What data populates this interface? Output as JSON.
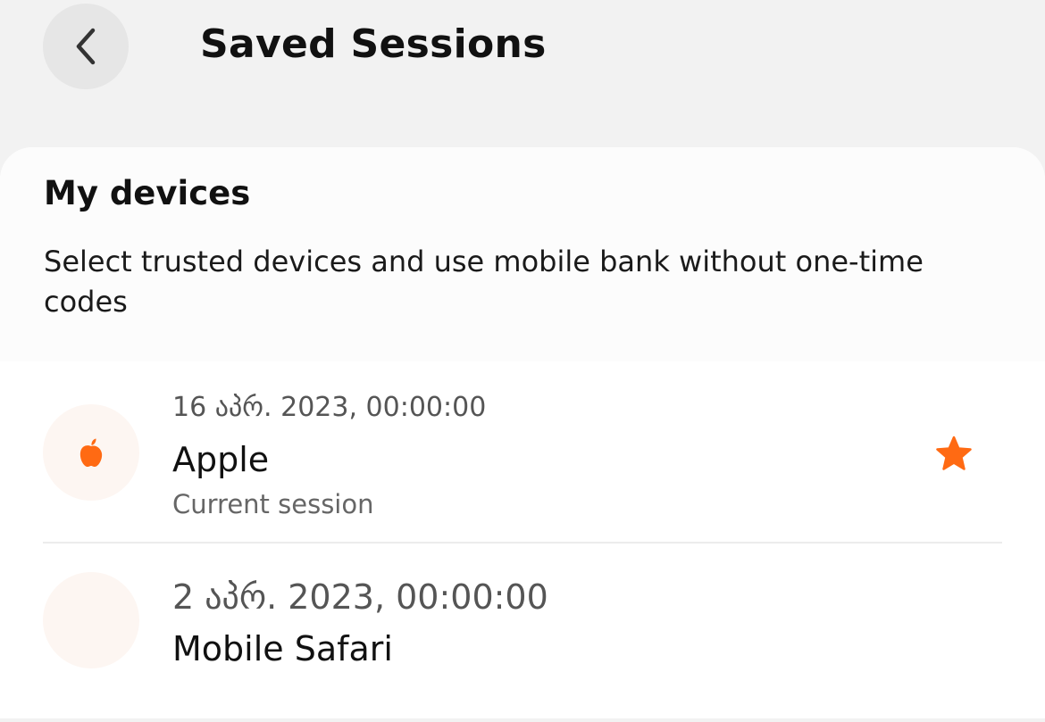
{
  "header": {
    "title": "Saved Sessions",
    "back_icon": "chevron-left-icon"
  },
  "devices": {
    "title": "My devices",
    "description": "Select trusted devices and use mobile bank without one-time codes"
  },
  "sessions": [
    {
      "date": "16 აპრ. 2023, 00:00:00",
      "name": "Apple",
      "status": "Current session",
      "icon": "apple-icon",
      "favorite": true,
      "favorite_icon": "star-icon"
    },
    {
      "date": "2 აპრ. 2023, 00:00:00",
      "name": "Mobile Safari",
      "icon": "device-icon"
    }
  ],
  "colors": {
    "accent": "#ff6a13",
    "background": "#f2f2f2",
    "card": "#ffffff",
    "avatar_bg": "#fdf6f2"
  }
}
